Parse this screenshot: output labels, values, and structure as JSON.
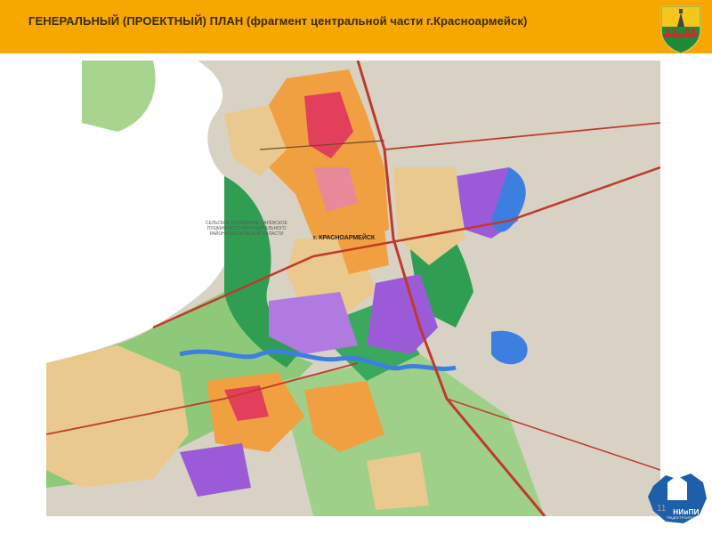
{
  "header": {
    "title": "ГЕНЕРАЛЬНЫЙ  (ПРОЕКТНЫЙ)  ПЛАН  (фрагмент  центральной части  г.Красноармейск)"
  },
  "map": {
    "city_label": "г. КРАСНОАРМЕЙСК",
    "rural_area_label": "СЕЛЬСКОЕ ПОСЕЛЕНИЕ ЦАРЁВСКОЕ ПУШКИНСКОГО МУНИЦИПАЛЬНОГО РАЙОНА МОСКОВСКОЙ ОБЛАСТИ",
    "colors": {
      "residential_low": "#e9c98e",
      "residential_mid": "#f0a040",
      "public": "#e23f5a",
      "industrial": "#9b5bd8",
      "forest": "#2f9e52",
      "greenery": "#8ec97a",
      "water": "#3d7fe0",
      "roads": "#c0392b",
      "agricultural": "#d8d2c4"
    }
  },
  "logo": {
    "main_text": "НИиПИ",
    "sub_text": "ГРАДОСТРОИТЕЛЬСТВА",
    "color": "#1d5fa8"
  },
  "slide_number": "11"
}
